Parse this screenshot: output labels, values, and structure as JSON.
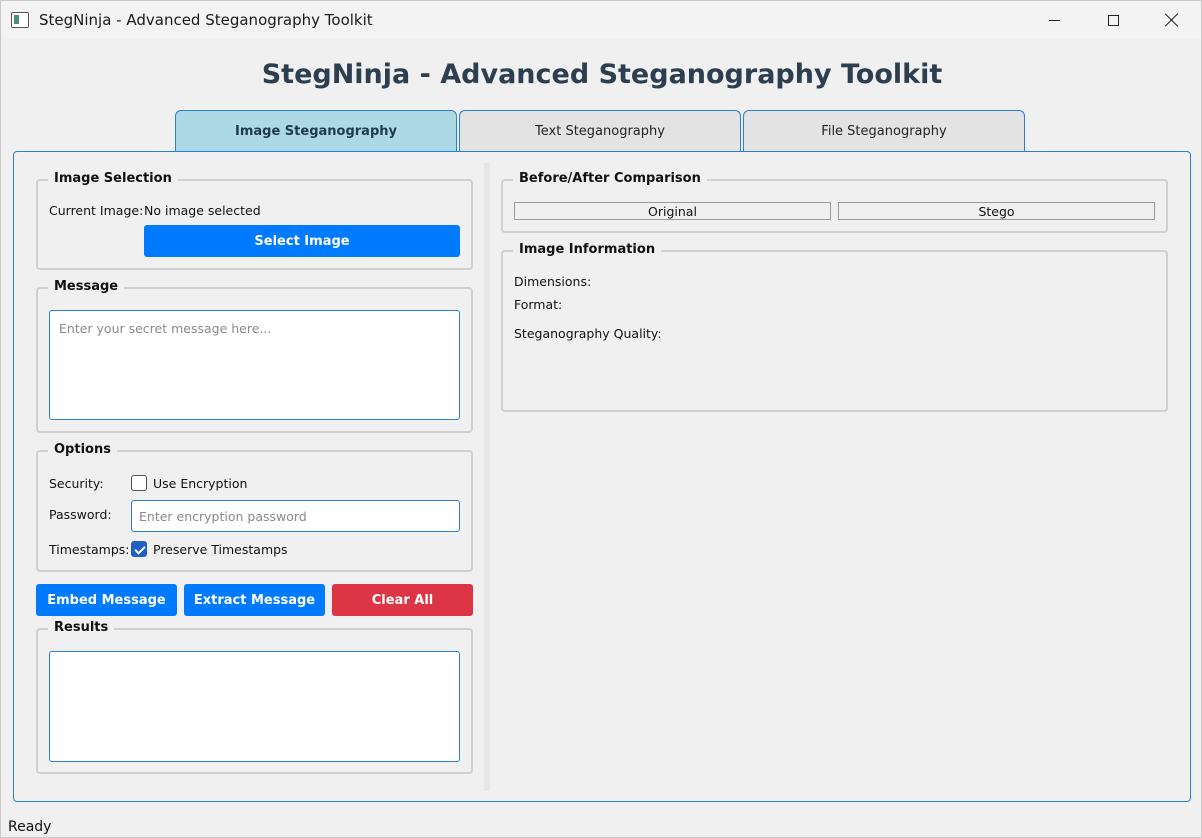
{
  "window": {
    "title": "StegNinja - Advanced Steganography Toolkit"
  },
  "header": {
    "title": "StegNinja - Advanced Steganography Toolkit"
  },
  "tabs": [
    {
      "label": "Image Steganography",
      "active": true
    },
    {
      "label": "Text Steganography",
      "active": false
    },
    {
      "label": "File Steganography",
      "active": false
    }
  ],
  "image_selection": {
    "title": "Image Selection",
    "current_label": "Current Image:",
    "current_value": "No image selected",
    "select_button": "Select Image"
  },
  "message": {
    "title": "Message",
    "placeholder": "Enter your secret message here..."
  },
  "options": {
    "title": "Options",
    "security_label": "Security:",
    "encryption_label": "Use Encryption",
    "encryption_checked": false,
    "password_label": "Password:",
    "password_placeholder": "Enter encryption password",
    "timestamps_label": "Timestamps:",
    "preserve_label": "Preserve Timestamps",
    "preserve_checked": true
  },
  "actions": {
    "embed": "Embed Message",
    "extract": "Extract Message",
    "clear": "Clear All"
  },
  "results": {
    "title": "Results"
  },
  "comparison": {
    "title": "Before/After Comparison",
    "original": "Original",
    "stego": "Stego"
  },
  "image_info": {
    "title": "Image Information",
    "dimensions": "Dimensions:",
    "format": "Format:",
    "quality": "Steganography Quality:"
  },
  "status": {
    "text": "Ready"
  },
  "colors": {
    "accent": "#007bff",
    "danger": "#dc3545",
    "active_tab": "#add8e6",
    "header_text": "#2c3e50"
  }
}
